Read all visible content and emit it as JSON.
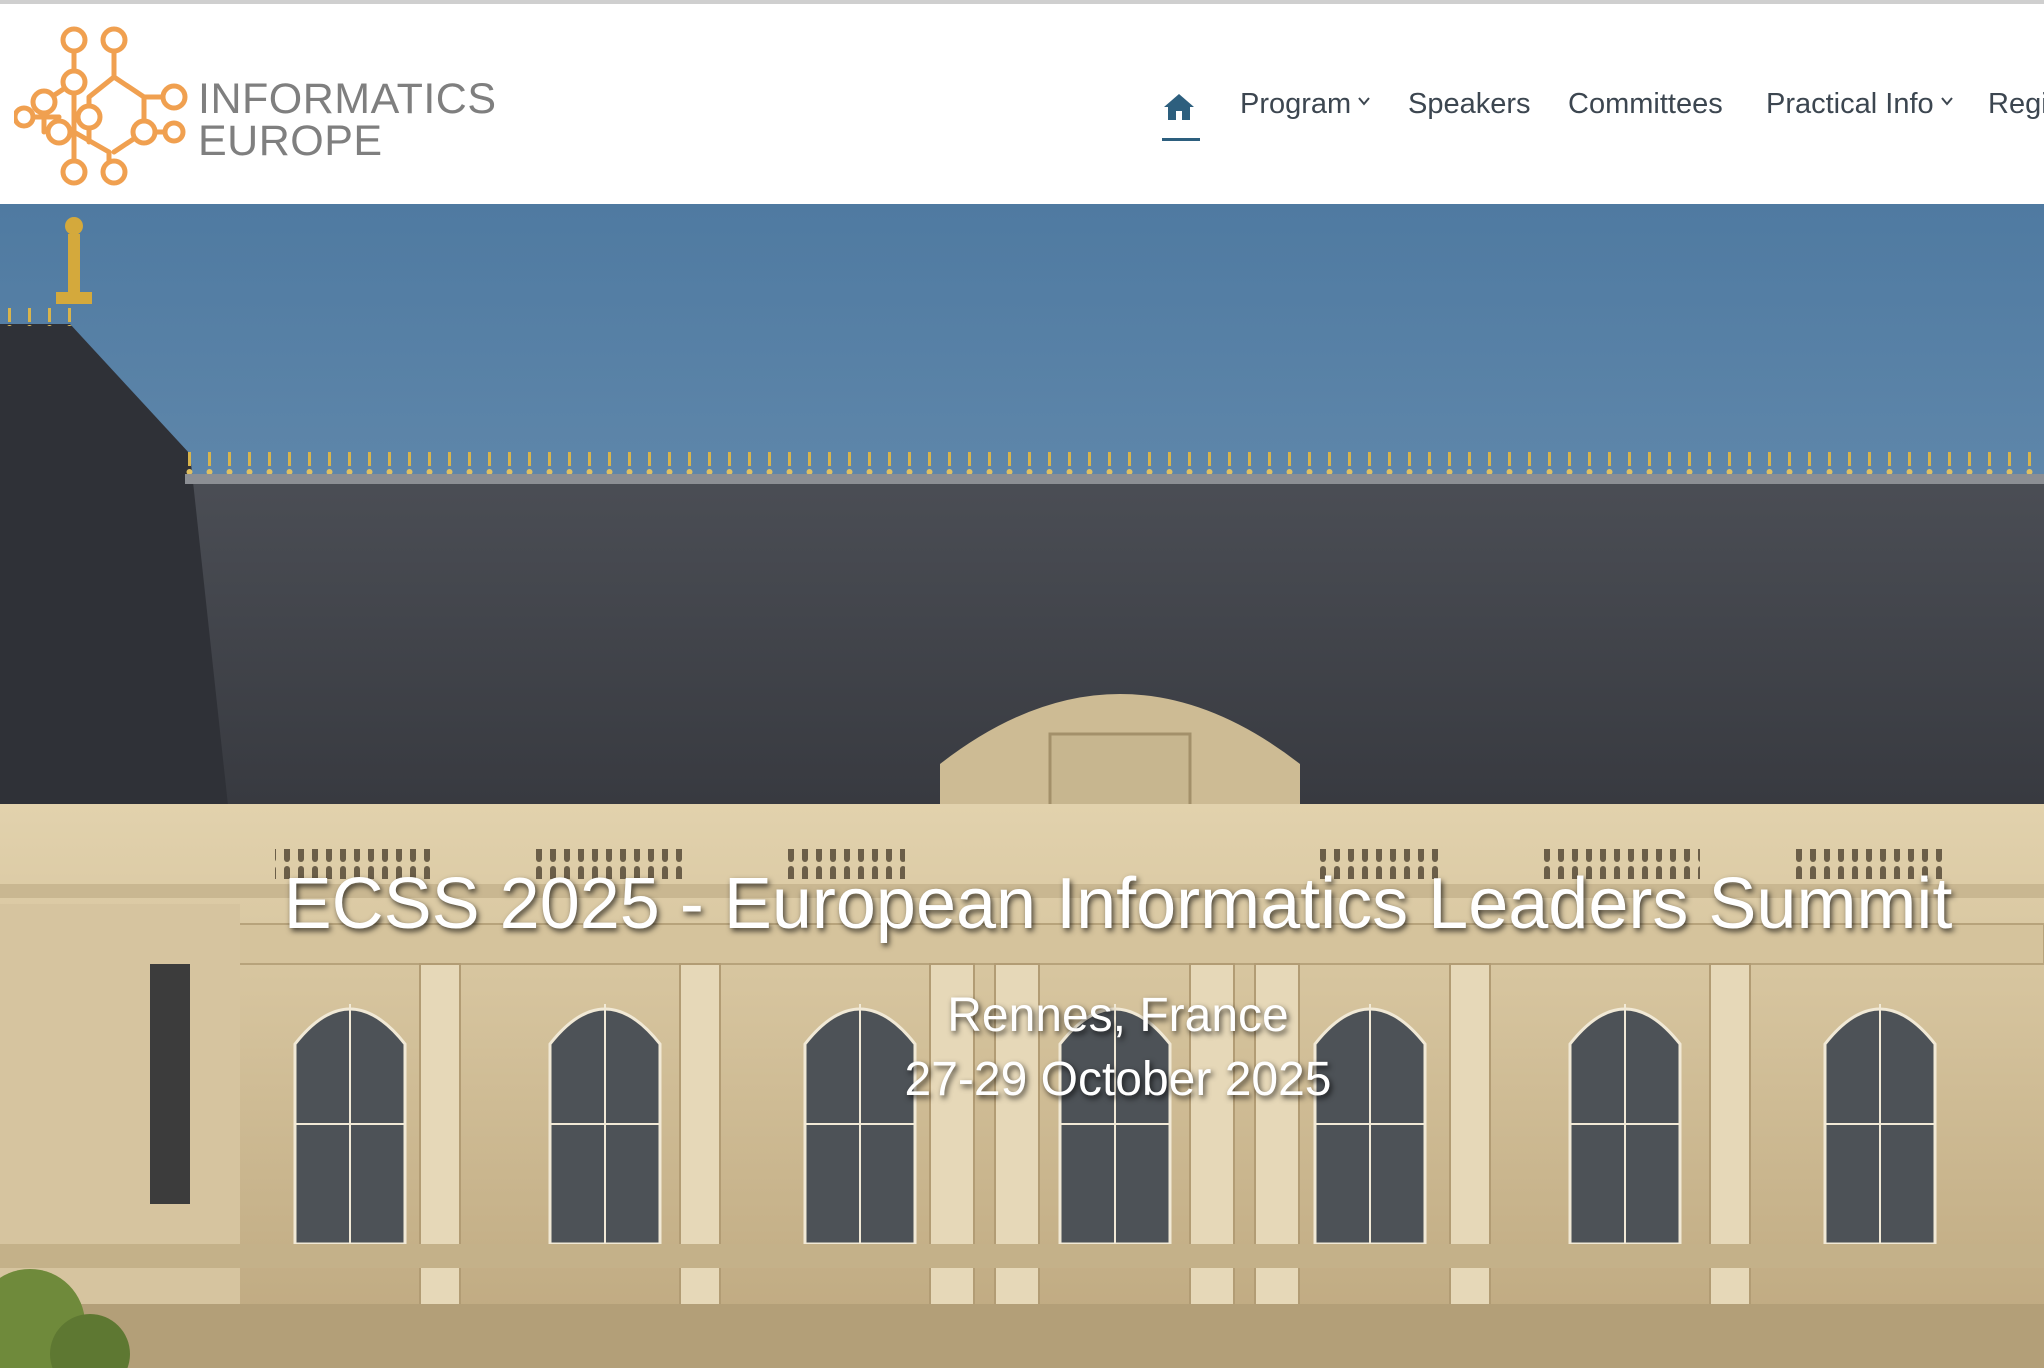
{
  "brand": {
    "line1": "INFORMATICS",
    "line2": "EUROPE",
    "logo_color": "#f0a050",
    "text_color": "#7f7f7f"
  },
  "nav": {
    "home_icon": "home-icon",
    "items": [
      {
        "label": "Program",
        "has_dropdown": true
      },
      {
        "label": "Speakers",
        "has_dropdown": false
      },
      {
        "label": "Committees",
        "has_dropdown": false
      },
      {
        "label": "Practical Info",
        "has_dropdown": true
      },
      {
        "label": "Regi",
        "has_dropdown": false
      }
    ],
    "active": "home",
    "accent": "#2d5f7e"
  },
  "hero": {
    "title": "ECSS 2025 - European Informatics Leaders Summit",
    "location": "Rennes, France",
    "dates": "27-29 October 2025",
    "sky_color": "#5f87ab",
    "roof_color": "#3f4249",
    "stone_color": "#d8c6a0"
  }
}
